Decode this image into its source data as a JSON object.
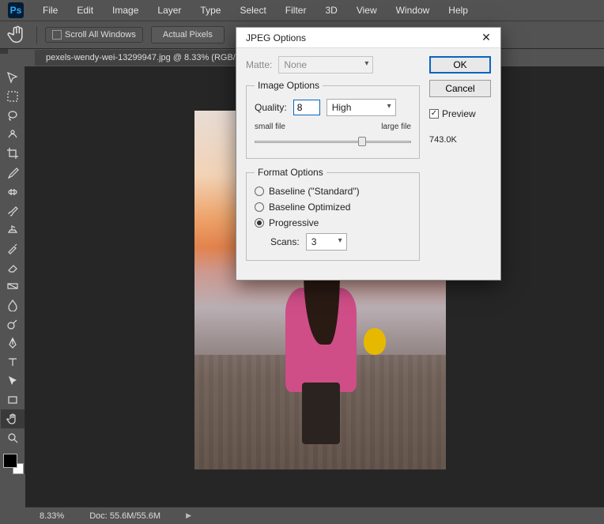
{
  "app": {
    "logo": "Ps"
  },
  "menu": {
    "items": [
      "File",
      "Edit",
      "Image",
      "Layer",
      "Type",
      "Select",
      "Filter",
      "3D",
      "View",
      "Window",
      "Help"
    ]
  },
  "options_bar": {
    "scroll_all": "Scroll All Windows",
    "actual_pixels": "Actual Pixels"
  },
  "document": {
    "tab": "pexels-wendy-wei-13299947.jpg @ 8.33% (RGB/"
  },
  "status": {
    "zoom": "8.33%",
    "doc": "Doc: 55.6M/55.6M"
  },
  "dialog": {
    "title": "JPEG Options",
    "matte_label": "Matte:",
    "matte_value": "None",
    "ok": "OK",
    "cancel": "Cancel",
    "preview": "Preview",
    "filesize": "743.0K",
    "image_options": {
      "legend": "Image Options",
      "quality_label": "Quality:",
      "quality_value": "8",
      "quality_preset": "High",
      "small": "small file",
      "large": "large file",
      "slider_pos": 0.66
    },
    "format_options": {
      "legend": "Format Options",
      "baseline_standard": "Baseline (\"Standard\")",
      "baseline_optimized": "Baseline Optimized",
      "progressive": "Progressive",
      "selected": "progressive",
      "scans_label": "Scans:",
      "scans_value": "3"
    }
  }
}
